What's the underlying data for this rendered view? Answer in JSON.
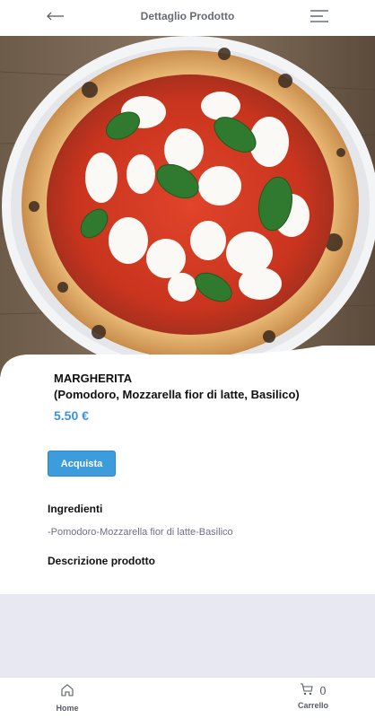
{
  "header": {
    "title": "Dettaglio Prodotto",
    "back_icon": "arrow-left-icon",
    "menu_icon": "hamburger-menu-icon"
  },
  "product": {
    "name": "MARGHERITA",
    "subtitle": "(Pomodoro, Mozzarella fior di latte, Basilico)",
    "price": "5.50 €",
    "buy_label": "Acquista",
    "ingredients_title": "Ingredienti",
    "ingredients_text": "-Pomodoro-Mozzarella fior di latte-Basilico",
    "description_title": "Descrizione prodotto"
  },
  "nav": {
    "home_label": "Home",
    "cart_label": "Carrello",
    "cart_count": "0",
    "home_icon": "home-icon",
    "cart_icon": "cart-icon"
  },
  "colors": {
    "accent": "#3a95d6",
    "button": "#3d9cdc",
    "grey_band": "#e7e8f2"
  }
}
